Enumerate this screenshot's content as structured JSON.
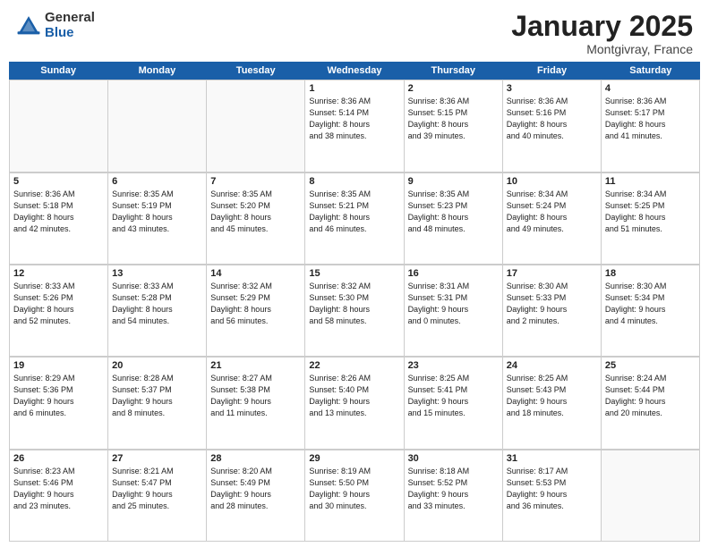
{
  "logo": {
    "general": "General",
    "blue": "Blue"
  },
  "title": "January 2025",
  "subtitle": "Montgivray, France",
  "days": [
    "Sunday",
    "Monday",
    "Tuesday",
    "Wednesday",
    "Thursday",
    "Friday",
    "Saturday"
  ],
  "weeks": [
    [
      {
        "day": "",
        "info": ""
      },
      {
        "day": "",
        "info": ""
      },
      {
        "day": "",
        "info": ""
      },
      {
        "day": "1",
        "info": "Sunrise: 8:36 AM\nSunset: 5:14 PM\nDaylight: 8 hours\nand 38 minutes."
      },
      {
        "day": "2",
        "info": "Sunrise: 8:36 AM\nSunset: 5:15 PM\nDaylight: 8 hours\nand 39 minutes."
      },
      {
        "day": "3",
        "info": "Sunrise: 8:36 AM\nSunset: 5:16 PM\nDaylight: 8 hours\nand 40 minutes."
      },
      {
        "day": "4",
        "info": "Sunrise: 8:36 AM\nSunset: 5:17 PM\nDaylight: 8 hours\nand 41 minutes."
      }
    ],
    [
      {
        "day": "5",
        "info": "Sunrise: 8:36 AM\nSunset: 5:18 PM\nDaylight: 8 hours\nand 42 minutes."
      },
      {
        "day": "6",
        "info": "Sunrise: 8:35 AM\nSunset: 5:19 PM\nDaylight: 8 hours\nand 43 minutes."
      },
      {
        "day": "7",
        "info": "Sunrise: 8:35 AM\nSunset: 5:20 PM\nDaylight: 8 hours\nand 45 minutes."
      },
      {
        "day": "8",
        "info": "Sunrise: 8:35 AM\nSunset: 5:21 PM\nDaylight: 8 hours\nand 46 minutes."
      },
      {
        "day": "9",
        "info": "Sunrise: 8:35 AM\nSunset: 5:23 PM\nDaylight: 8 hours\nand 48 minutes."
      },
      {
        "day": "10",
        "info": "Sunrise: 8:34 AM\nSunset: 5:24 PM\nDaylight: 8 hours\nand 49 minutes."
      },
      {
        "day": "11",
        "info": "Sunrise: 8:34 AM\nSunset: 5:25 PM\nDaylight: 8 hours\nand 51 minutes."
      }
    ],
    [
      {
        "day": "12",
        "info": "Sunrise: 8:33 AM\nSunset: 5:26 PM\nDaylight: 8 hours\nand 52 minutes."
      },
      {
        "day": "13",
        "info": "Sunrise: 8:33 AM\nSunset: 5:28 PM\nDaylight: 8 hours\nand 54 minutes."
      },
      {
        "day": "14",
        "info": "Sunrise: 8:32 AM\nSunset: 5:29 PM\nDaylight: 8 hours\nand 56 minutes."
      },
      {
        "day": "15",
        "info": "Sunrise: 8:32 AM\nSunset: 5:30 PM\nDaylight: 8 hours\nand 58 minutes."
      },
      {
        "day": "16",
        "info": "Sunrise: 8:31 AM\nSunset: 5:31 PM\nDaylight: 9 hours\nand 0 minutes."
      },
      {
        "day": "17",
        "info": "Sunrise: 8:30 AM\nSunset: 5:33 PM\nDaylight: 9 hours\nand 2 minutes."
      },
      {
        "day": "18",
        "info": "Sunrise: 8:30 AM\nSunset: 5:34 PM\nDaylight: 9 hours\nand 4 minutes."
      }
    ],
    [
      {
        "day": "19",
        "info": "Sunrise: 8:29 AM\nSunset: 5:36 PM\nDaylight: 9 hours\nand 6 minutes."
      },
      {
        "day": "20",
        "info": "Sunrise: 8:28 AM\nSunset: 5:37 PM\nDaylight: 9 hours\nand 8 minutes."
      },
      {
        "day": "21",
        "info": "Sunrise: 8:27 AM\nSunset: 5:38 PM\nDaylight: 9 hours\nand 11 minutes."
      },
      {
        "day": "22",
        "info": "Sunrise: 8:26 AM\nSunset: 5:40 PM\nDaylight: 9 hours\nand 13 minutes."
      },
      {
        "day": "23",
        "info": "Sunrise: 8:25 AM\nSunset: 5:41 PM\nDaylight: 9 hours\nand 15 minutes."
      },
      {
        "day": "24",
        "info": "Sunrise: 8:25 AM\nSunset: 5:43 PM\nDaylight: 9 hours\nand 18 minutes."
      },
      {
        "day": "25",
        "info": "Sunrise: 8:24 AM\nSunset: 5:44 PM\nDaylight: 9 hours\nand 20 minutes."
      }
    ],
    [
      {
        "day": "26",
        "info": "Sunrise: 8:23 AM\nSunset: 5:46 PM\nDaylight: 9 hours\nand 23 minutes."
      },
      {
        "day": "27",
        "info": "Sunrise: 8:21 AM\nSunset: 5:47 PM\nDaylight: 9 hours\nand 25 minutes."
      },
      {
        "day": "28",
        "info": "Sunrise: 8:20 AM\nSunset: 5:49 PM\nDaylight: 9 hours\nand 28 minutes."
      },
      {
        "day": "29",
        "info": "Sunrise: 8:19 AM\nSunset: 5:50 PM\nDaylight: 9 hours\nand 30 minutes."
      },
      {
        "day": "30",
        "info": "Sunrise: 8:18 AM\nSunset: 5:52 PM\nDaylight: 9 hours\nand 33 minutes."
      },
      {
        "day": "31",
        "info": "Sunrise: 8:17 AM\nSunset: 5:53 PM\nDaylight: 9 hours\nand 36 minutes."
      },
      {
        "day": "",
        "info": ""
      }
    ]
  ]
}
